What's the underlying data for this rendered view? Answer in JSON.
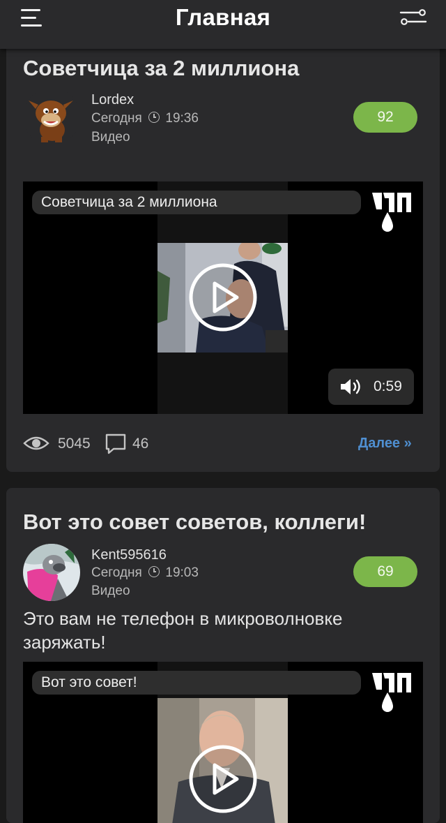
{
  "header": {
    "title": "Главная",
    "menu_icon": "hamburger-menu-icon",
    "filter_icon": "filter-sliders-icon"
  },
  "colors": {
    "background": "#1a1a1a",
    "card": "#2a2a2c",
    "rating_green": "#7cb64a",
    "link_blue": "#4f8fd1"
  },
  "posts": [
    {
      "title": "Советчица за 2 миллиона",
      "author": "Lordex",
      "date": "Сегодня",
      "time": "19:36",
      "category": "Видео",
      "rating": "92",
      "video": {
        "title": "Советчица за 2 миллиона",
        "duration": "0:59"
      },
      "views": "5045",
      "comments": "46",
      "more_label": "Далее »"
    },
    {
      "title": "Вот это совет советов, коллеги!",
      "author": "Kent595616",
      "date": "Сегодня",
      "time": "19:03",
      "category": "Видео",
      "rating": "69",
      "description": "Это вам не телефон в микроволновке заряжать!",
      "video": {
        "title": "Вот это совет!"
      }
    }
  ]
}
